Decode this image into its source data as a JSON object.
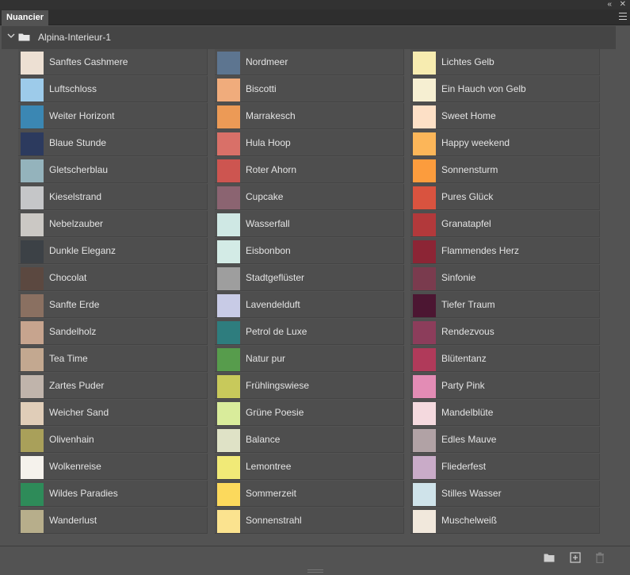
{
  "panel": {
    "tab_label": "Nuancier"
  },
  "group": {
    "name": "Alpina-Interieur-1"
  },
  "columns": [
    [
      {
        "name": "Sanftes Cashmere",
        "color": "#ede0d3"
      },
      {
        "name": "Luftschloss",
        "color": "#9dcbea"
      },
      {
        "name": "Weiter Horizont",
        "color": "#3b87b3"
      },
      {
        "name": "Blaue Stunde",
        "color": "#2c3a5e"
      },
      {
        "name": "Gletscherblau",
        "color": "#94b3bc"
      },
      {
        "name": "Kieselstrand",
        "color": "#c5c6c8"
      },
      {
        "name": "Nebelzauber",
        "color": "#cbc8c4"
      },
      {
        "name": "Dunkle Eleganz",
        "color": "#3c4146"
      },
      {
        "name": "Chocolat",
        "color": "#5b4840"
      },
      {
        "name": "Sanfte Erde",
        "color": "#8a7061"
      },
      {
        "name": "Sandelholz",
        "color": "#c7a48e"
      },
      {
        "name": "Tea Time",
        "color": "#c3a890"
      },
      {
        "name": "Zartes Puder",
        "color": "#c0b4ab"
      },
      {
        "name": "Weicher Sand",
        "color": "#e0cdb8"
      },
      {
        "name": "Olivenhain",
        "color": "#a9a05a"
      },
      {
        "name": "Wolkenreise",
        "color": "#f5f2ec"
      },
      {
        "name": "Wildes Paradies",
        "color": "#2e8b59"
      },
      {
        "name": "Wanderlust",
        "color": "#b7ae8b"
      }
    ],
    [
      {
        "name": "Nordmeer",
        "color": "#5d7590"
      },
      {
        "name": "Biscotti",
        "color": "#f0ac7c"
      },
      {
        "name": "Marrakesch",
        "color": "#ec9a56"
      },
      {
        "name": "Hula Hoop",
        "color": "#d97068"
      },
      {
        "name": "Roter Ahorn",
        "color": "#cd5550"
      },
      {
        "name": "Cupcake",
        "color": "#8b6471"
      },
      {
        "name": "Wasserfall",
        "color": "#cfe8e4"
      },
      {
        "name": "Eisbonbon",
        "color": "#d3ebe6"
      },
      {
        "name": "Stadtgeflüster",
        "color": "#9e9e9e"
      },
      {
        "name": "Lavendelduft",
        "color": "#c8cbe6"
      },
      {
        "name": "Petrol de Luxe",
        "color": "#2e7d7e"
      },
      {
        "name": "Natur pur",
        "color": "#579c4c"
      },
      {
        "name": "Frühlingswiese",
        "color": "#c8c95b"
      },
      {
        "name": "Grüne Poesie",
        "color": "#d9ec9b"
      },
      {
        "name": "Balance",
        "color": "#dfe2c6"
      },
      {
        "name": "Lemontree",
        "color": "#f1ea77"
      },
      {
        "name": "Sommerzeit",
        "color": "#fcd95c"
      },
      {
        "name": "Sonnenstrahl",
        "color": "#fbe38f"
      }
    ],
    [
      {
        "name": "Lichtes Gelb",
        "color": "#f7ecb0"
      },
      {
        "name": "Ein Hauch von Gelb",
        "color": "#f6efd2"
      },
      {
        "name": "Sweet Home",
        "color": "#fde0c6"
      },
      {
        "name": "Happy weekend",
        "color": "#fcb659"
      },
      {
        "name": "Sonnensturm",
        "color": "#fc9c3d"
      },
      {
        "name": "Pures Glück",
        "color": "#d9533f"
      },
      {
        "name": "Granatapfel",
        "color": "#b2393b"
      },
      {
        "name": "Flammendes Herz",
        "color": "#8c2535"
      },
      {
        "name": "Sinfonie",
        "color": "#7a3b4e"
      },
      {
        "name": "Tiefer Traum",
        "color": "#4c1632"
      },
      {
        "name": "Rendezvous",
        "color": "#8c3d5b"
      },
      {
        "name": "Blütentanz",
        "color": "#b03a5a"
      },
      {
        "name": "Party Pink",
        "color": "#e38cb5"
      },
      {
        "name": "Mandelblüte",
        "color": "#f4d9de"
      },
      {
        "name": "Edles Mauve",
        "color": "#b1a2a5"
      },
      {
        "name": "Fliederfest",
        "color": "#c9abc8"
      },
      {
        "name": "Stilles Wasser",
        "color": "#cfe3ea"
      },
      {
        "name": "Muschelweiß",
        "color": "#f1e8dc"
      }
    ]
  ],
  "icons": {
    "collapse": "double-chevron-right-icon",
    "close": "close-icon",
    "menu": "hamburger-menu-icon",
    "group_toggle": "chevron-down-icon",
    "folder": "folder-icon",
    "new_group": "new-folder-icon",
    "new_swatch": "add-swatch-icon",
    "delete": "trash-icon"
  }
}
